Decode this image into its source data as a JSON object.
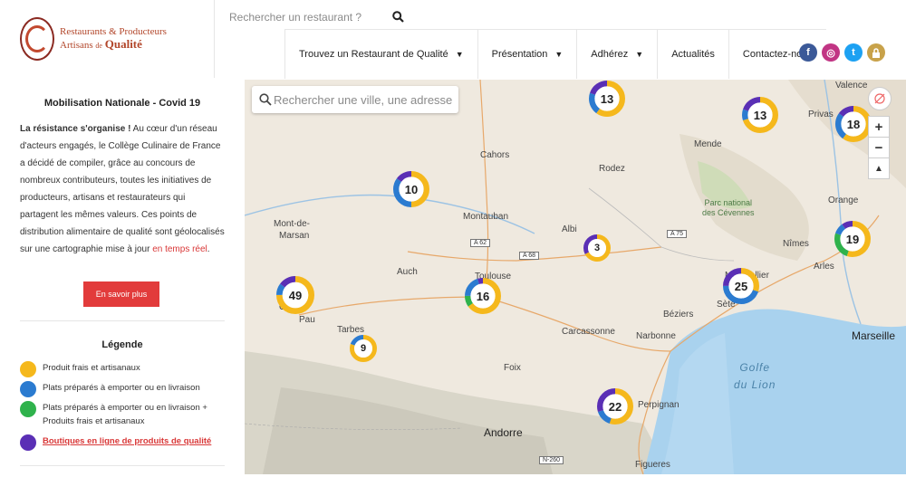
{
  "header": {
    "logo_line1": "Restaurants & Producteurs",
    "logo_line2a": "Artisans",
    "logo_line2b": "de",
    "logo_line2c": "Qualité",
    "search_placeholder": "Rechercher un restaurant ?",
    "nav": [
      {
        "label": "Trouvez un Restaurant de Qualité",
        "has_dropdown": true
      },
      {
        "label": "Présentation",
        "has_dropdown": true
      },
      {
        "label": "Adhérez",
        "has_dropdown": true
      },
      {
        "label": "Actualités",
        "has_dropdown": false
      },
      {
        "label": "Contactez-nous",
        "has_dropdown": false
      }
    ],
    "socials": [
      {
        "name": "facebook-icon",
        "glyph": "f",
        "color": "#3b5998"
      },
      {
        "name": "instagram-icon",
        "glyph": "◎",
        "color": "#c13584"
      },
      {
        "name": "twitter-icon",
        "glyph": "t",
        "color": "#1da1f2"
      },
      {
        "name": "lock-icon",
        "glyph": "🔒",
        "color": "#c8a24a"
      }
    ]
  },
  "sidebar": {
    "title": "Mobilisation Nationale - Covid 19",
    "para_bold": "La résistance s'organise !",
    "para_text": " Au cœur d'un réseau d'acteurs engagés, le Collège Culinaire de France a décidé de compiler, grâce au concours de nombreux contributeurs, toutes les initiatives de producteurs, artisans et restaurateurs qui partagent les mêmes valeurs. Ces points de distribution alimentaire de qualité sont géolocalisés sur une cartographie mise à jour ",
    "para_link": "en temps réel",
    "para_end": ".",
    "button": "En savoir plus",
    "legend_title": "Légende",
    "legend": [
      {
        "label": "Produit frais et artisanaux",
        "color": "#f5b81c"
      },
      {
        "label": "Plats préparés à emporter ou en livraison",
        "color": "#2b7bd0"
      },
      {
        "label": "Plats préparés à emporter ou en livraison + Produits frais et artisanaux",
        "color": "#2fb24c"
      },
      {
        "label": "Boutiques en ligne de produits de qualité",
        "color": "#5a2fb5"
      }
    ]
  },
  "map": {
    "search_placeholder": "Rechercher une ville, une adresse",
    "zoom_in": "+",
    "zoom_out": "−",
    "compass": "▲",
    "places": {
      "valence": "Valence",
      "privas": "Privas",
      "mende": "Mende",
      "cahors": "Cahors",
      "rodez": "Rodez",
      "montauban": "Montauban",
      "albi": "Albi",
      "mont": "Mont-de-",
      "marsan": "Marsan",
      "auch": "Auch",
      "toulouse": "Toulouse",
      "pau": "Pau",
      "tarbes": "Tarbes",
      "carcassonne": "Carcassonne",
      "narbonne": "Narbonne",
      "beziers": "Béziers",
      "sete": "Sète",
      "montpellier": "Montpellier",
      "nimes": "Nîmes",
      "arles": "Arles",
      "orange": "Orange",
      "marseille": "Marseille",
      "foix": "Foix",
      "andorre": "Andorre",
      "figueres": "Figueres",
      "perpignan": "Perpignan",
      "parc1": "Parc national",
      "parc2": "des Cévennes",
      "golfe1": "Golfe",
      "golfe2": "du Lion",
      "o": "O"
    },
    "roads": {
      "a62": "A 62",
      "a68": "A 68",
      "a75": "A 75",
      "n260": "N-260"
    },
    "clusters": [
      {
        "value": "13",
        "yellow": 0.6,
        "blue": 0.2,
        "purple": 0.2,
        "green": 0
      },
      {
        "value": "13",
        "yellow": 0.7,
        "blue": 0.1,
        "purple": 0.2,
        "green": 0
      },
      {
        "value": "18",
        "yellow": 0.6,
        "blue": 0.25,
        "purple": 0.15,
        "green": 0
      },
      {
        "value": "10",
        "yellow": 0.5,
        "blue": 0.35,
        "purple": 0.15,
        "green": 0
      },
      {
        "value": "3",
        "yellow": 0.67,
        "blue": 0,
        "purple": 0.33,
        "green": 0
      },
      {
        "value": "19",
        "yellow": 0.55,
        "blue": 0.1,
        "purple": 0.1,
        "green": 0.25
      },
      {
        "value": "49",
        "yellow": 0.75,
        "blue": 0.1,
        "purple": 0.15,
        "green": 0
      },
      {
        "value": "16",
        "yellow": 0.65,
        "blue": 0.2,
        "purple": 0.05,
        "green": 0.1
      },
      {
        "value": "25",
        "yellow": 0.3,
        "blue": 0.45,
        "purple": 0.25,
        "green": 0
      },
      {
        "value": "9",
        "yellow": 0.8,
        "blue": 0.2,
        "purple": 0,
        "green": 0
      },
      {
        "value": "22",
        "yellow": 0.55,
        "blue": 0.15,
        "purple": 0.3,
        "green": 0
      }
    ]
  }
}
